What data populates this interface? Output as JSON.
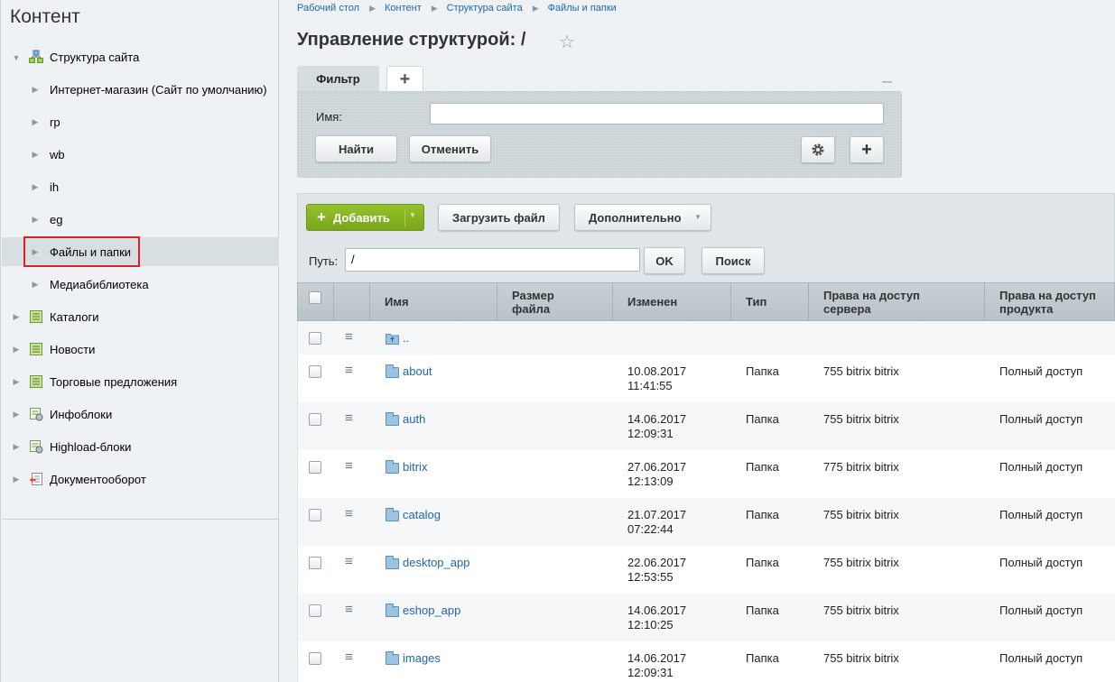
{
  "sidebar": {
    "title": "Контент",
    "items": [
      {
        "label": "Структура сайта",
        "icon": "site-structure-icon",
        "expanded": true
      },
      {
        "label": "Интернет-магазин (Сайт по умолчанию)"
      },
      {
        "label": "rp"
      },
      {
        "label": "wb"
      },
      {
        "label": "ih"
      },
      {
        "label": "eg"
      },
      {
        "label": "Файлы и папки",
        "selected": true
      },
      {
        "label": "Медиабиблиотека"
      },
      {
        "label": "Каталоги",
        "icon": "catalog-icon"
      },
      {
        "label": "Новости",
        "icon": "news-icon"
      },
      {
        "label": "Торговые предложения",
        "icon": "offers-icon"
      },
      {
        "label": "Инфоблоки",
        "icon": "iblock-icon"
      },
      {
        "label": "Highload-блоки",
        "icon": "highload-icon"
      },
      {
        "label": "Документооборот",
        "icon": "workflow-icon"
      }
    ]
  },
  "breadcrumb": [
    "Рабочий стол",
    "Контент",
    "Структура сайта",
    "Файлы и папки"
  ],
  "page": {
    "title": "Управление структурой: /"
  },
  "filter": {
    "tab_label": "Фильтр",
    "add_tab": "+",
    "minimize": "–",
    "name_label": "Имя:",
    "name_value": "",
    "find_button": "Найти",
    "cancel_button": "Отменить",
    "add_button": "+"
  },
  "toolbar": {
    "add_button": "Добавить",
    "upload_button": "Загрузить файл",
    "more_button": "Дополнительно",
    "path_label": "Путь:",
    "path_value": "/",
    "ok_button": "OK",
    "search_button": "Поиск"
  },
  "table": {
    "columns": [
      "Имя",
      "Размер файла",
      "Изменен",
      "Тип",
      "Права на доступ сервера",
      "Права на доступ продукта"
    ],
    "columns_split": {
      "size": [
        "Размер",
        "файла"
      ],
      "server": [
        "Права на доступ",
        "сервера"
      ],
      "product": [
        "Права на доступ",
        "продукта"
      ]
    },
    "parent_row": "..",
    "rows": [
      {
        "name": "about",
        "date": "10.08.2017",
        "time": "11:41:55",
        "type": "Папка",
        "server": "755 bitrix bitrix",
        "product": "Полный доступ"
      },
      {
        "name": "auth",
        "date": "14.06.2017",
        "time": "12:09:31",
        "type": "Папка",
        "server": "755 bitrix bitrix",
        "product": "Полный доступ"
      },
      {
        "name": "bitrix",
        "date": "27.06.2017",
        "time": "12:13:09",
        "type": "Папка",
        "server": "775 bitrix bitrix",
        "product": "Полный доступ"
      },
      {
        "name": "catalog",
        "date": "21.07.2017",
        "time": "07:22:44",
        "type": "Папка",
        "server": "755 bitrix bitrix",
        "product": "Полный доступ"
      },
      {
        "name": "desktop_app",
        "date": "22.06.2017",
        "time": "12:53:55",
        "type": "Папка",
        "server": "755 bitrix bitrix",
        "product": "Полный доступ"
      },
      {
        "name": "eshop_app",
        "date": "14.06.2017",
        "time": "12:10:25",
        "type": "Папка",
        "server": "755 bitrix bitrix",
        "product": "Полный доступ"
      },
      {
        "name": "images",
        "date": "14.06.2017",
        "time": "12:09:31",
        "type": "Папка",
        "server": "755 bitrix bitrix",
        "product": "Полный доступ"
      }
    ]
  }
}
